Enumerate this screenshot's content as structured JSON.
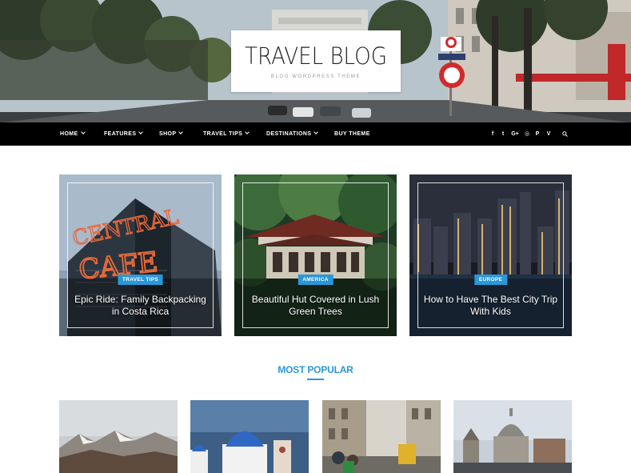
{
  "site": {
    "title": "TRAVEL BLOG",
    "tagline": "BLOG WORDPRESS THEME"
  },
  "nav": {
    "items": [
      {
        "label": "HOME",
        "has_dropdown": true
      },
      {
        "label": "FEATURES",
        "has_dropdown": true
      },
      {
        "label": "SHOP",
        "has_dropdown": true
      },
      {
        "label": "TRAVEL TIPS",
        "has_dropdown": true
      },
      {
        "label": "DESTINATIONS",
        "has_dropdown": true
      },
      {
        "label": "BUY THEME",
        "has_dropdown": false
      }
    ],
    "social": [
      {
        "icon": "facebook-icon",
        "glyph": "f"
      },
      {
        "icon": "twitter-icon",
        "glyph": "t"
      },
      {
        "icon": "google-plus-icon",
        "glyph": "G+"
      },
      {
        "icon": "instagram-icon",
        "glyph": "◎"
      },
      {
        "icon": "pinterest-icon",
        "glyph": "P"
      },
      {
        "icon": "vimeo-icon",
        "glyph": "V"
      }
    ],
    "search_icon": "search-icon"
  },
  "featured": [
    {
      "category": "TRAVEL TIPS",
      "title": "Epic Ride: Family Backpacking in Costa Rica",
      "image": "cafe-neon-building"
    },
    {
      "category": "AMERICA",
      "title": "Beautiful Hut Covered in Lush Green Trees",
      "image": "pagoda-in-forest"
    },
    {
      "category": "EUROPE",
      "title": "How to Have The Best City Trip With Kids",
      "image": "city-skyline-night"
    }
  ],
  "most_popular": {
    "heading": "MOST POPULAR",
    "images": [
      "snowy-mountains",
      "blue-dome-church",
      "tram-street",
      "cathedral-dome-city"
    ]
  },
  "colors": {
    "accent": "#2a98d8",
    "nav_bg": "#000000",
    "text_dark": "#222222"
  }
}
